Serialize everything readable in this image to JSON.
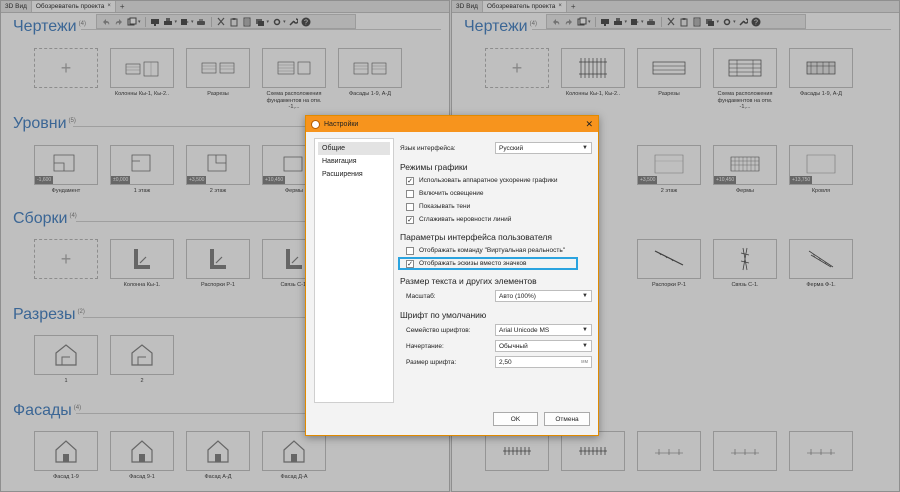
{
  "tabs_left": [
    {
      "label": "3D Вид"
    },
    {
      "label": "Обозреватель проекта"
    }
  ],
  "tabs_right": [
    {
      "label": "3D Вид"
    },
    {
      "label": "Обозреватель проекта"
    }
  ],
  "tab_close": "×",
  "tab_add": "+",
  "sections": [
    {
      "title": "Чертежи",
      "count": "(4)",
      "items": [
        "",
        "Колонны Кы-1, Кы-2..",
        "Разрезы",
        "Схема расположения фундаментов на отм. -1,...",
        "Фасады 1-9, А-Д"
      ]
    },
    {
      "title": "Уровни",
      "count": "(5)",
      "items": [
        "Фундамент",
        "1 этаж",
        "2 этаж",
        "Фермы",
        "Кровля"
      ],
      "elevations": [
        "-1,600",
        "±0,000",
        "+3,500",
        "+10,450",
        "+13,750"
      ]
    },
    {
      "title": "Сборки",
      "count": "(4)",
      "items": [
        "",
        "Колонна Кы-1.",
        "Распорки Р-1",
        "Связь С-1.",
        "Ферма Ф-1."
      ]
    },
    {
      "title": "Разрезы",
      "count": "(2)",
      "items": [
        "1",
        "2"
      ]
    },
    {
      "title": "Фасады",
      "count": "(4)",
      "items": [
        "Фасад 1-9",
        "Фасад 9-1",
        "Фасад А-Д",
        "Фасад Д-А"
      ]
    }
  ],
  "dialog": {
    "title": "Настройки",
    "close": "✕",
    "nav": [
      "Общие",
      "Навигация",
      "Расширения"
    ],
    "language_label": "Язык интерфейса:",
    "language_value": "Русский",
    "graphics_group": "Режимы графики",
    "graphics_options": [
      {
        "label": "Использовать аппаратное ускорение графики",
        "checked": "✓"
      },
      {
        "label": "Включить освещение",
        "checked": ""
      },
      {
        "label": "Показывать тени",
        "checked": ""
      },
      {
        "label": "Сглаживать неровности линий",
        "checked": "✓"
      }
    ],
    "ui_group": "Параметры интерфейса пользователя",
    "ui_options": [
      {
        "label": "Отображать команду \"Виртуальная реальность\"",
        "checked": ""
      },
      {
        "label": "Отображать эскизы вместо значков",
        "checked": "✓"
      }
    ],
    "size_group": "Размер текста и других элементов",
    "scale_label": "Масштаб:",
    "scale_value": "Авто (100%)",
    "font_group": "Шрифт по умолчанию",
    "family_label": "Семейство шрифтов:",
    "family_value": "Arial Unicode MS",
    "style_label": "Начертание:",
    "style_value": "Обычный",
    "size_label": "Размер шрифта:",
    "size_value": "2,50",
    "size_unit": "мм",
    "ok": "OK",
    "cancel": "Отмена"
  },
  "colors": {
    "accent": "#f7941d",
    "section_title": "#4f89c7",
    "highlight": "#2aa3df"
  }
}
